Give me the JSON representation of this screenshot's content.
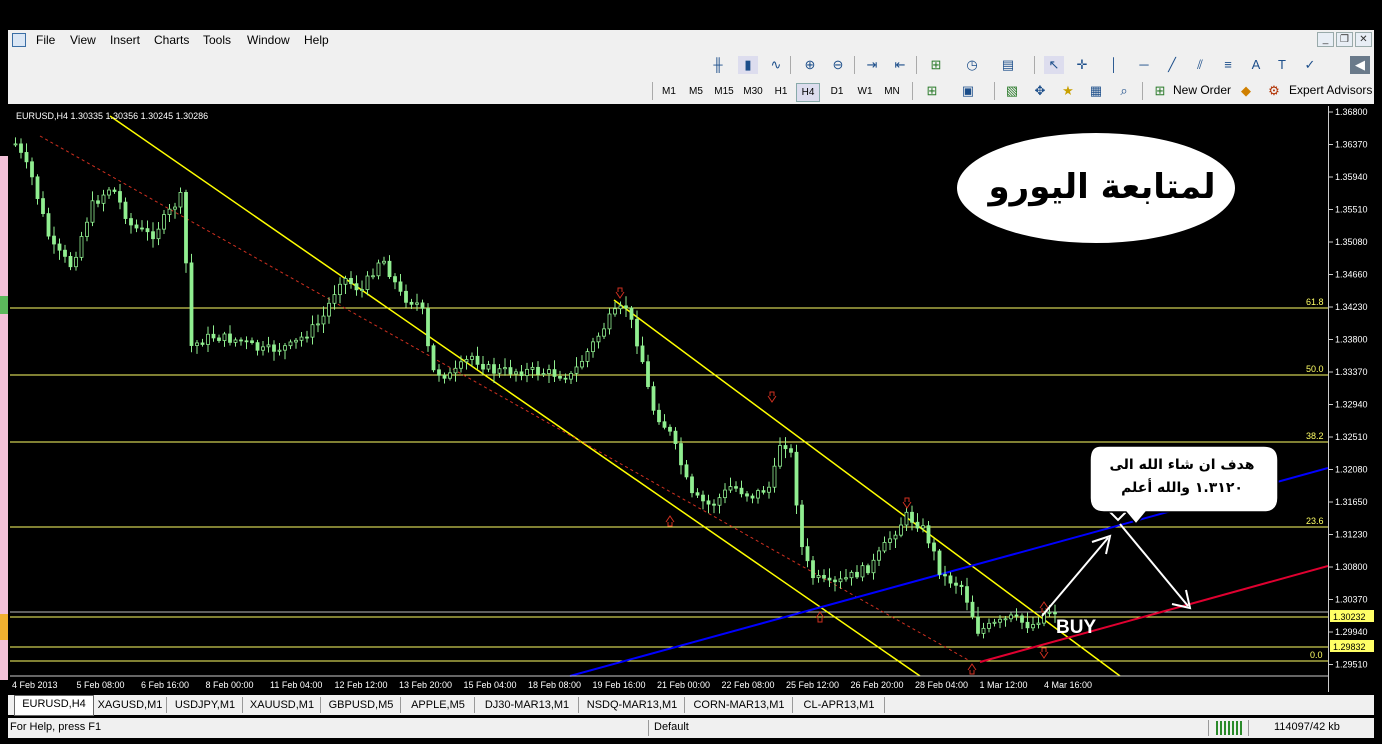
{
  "menu": {
    "items": [
      "File",
      "View",
      "Insert",
      "Charts",
      "Tools",
      "Window",
      "Help"
    ]
  },
  "timeframes": [
    "M1",
    "M5",
    "M15",
    "M30",
    "H1",
    "H4",
    "D1",
    "W1",
    "MN"
  ],
  "active_timeframe": "H4",
  "toolbar": {
    "new_order": "New Order",
    "expert_advisors": "Expert Advisors"
  },
  "chart": {
    "header": "EURUSD,H4  1.30335 1.30356 1.30245 1.30286",
    "y_ticks": [
      "1.36800",
      "1.36370",
      "1.35940",
      "1.35510",
      "1.35080",
      "1.34660",
      "1.34230",
      "1.33800",
      "1.33370",
      "1.32940",
      "1.32510",
      "1.32080",
      "1.31650",
      "1.31230",
      "1.30800",
      "1.30370",
      "1.29940",
      "1.29510"
    ],
    "x_ticks": [
      "4 Feb 2013",
      "5 Feb 08:00",
      "6 Feb 16:00",
      "8 Feb 00:00",
      "11 Feb 04:00",
      "12 Feb 12:00",
      "13 Feb 20:00",
      "15 Feb 04:00",
      "18 Feb 08:00",
      "19 Feb 16:00",
      "21 Feb 00:00",
      "22 Feb 08:00",
      "25 Feb 12:00",
      "26 Feb 20:00",
      "28 Feb 04:00",
      "1 Mar 12:00",
      "4 Mar 16:00"
    ],
    "price_tags": [
      "1.30232",
      "1.29832"
    ],
    "fib_levels": [
      "61.8",
      "50.0",
      "38.2",
      "23.6",
      "0.0"
    ],
    "title_ar": "لمتابعة اليورو",
    "target_line1": "هدف ان شاء الله الى",
    "target_line2": "١.٣١٢٠ والله أعلم",
    "buy_label": "BUY"
  },
  "tabs": [
    "EURUSD,H4",
    "XAGUSD,M1",
    "USDJPY,M1",
    "XAUUSD,M1",
    "GBPUSD,M5",
    "APPLE,M5",
    "DJ30-MAR13,M1",
    "NSDQ-MAR13,M1",
    "CORN-MAR13,M1",
    "CL-APR13,M1"
  ],
  "status": {
    "help": "For Help, press F1",
    "profile": "Default",
    "traffic": "114097/42 kb"
  },
  "colors": {
    "candle": "#90ee90",
    "fib": "#ffff66",
    "channel": "#ffff00",
    "support": "#0000ff",
    "trend": "#e00030"
  }
}
